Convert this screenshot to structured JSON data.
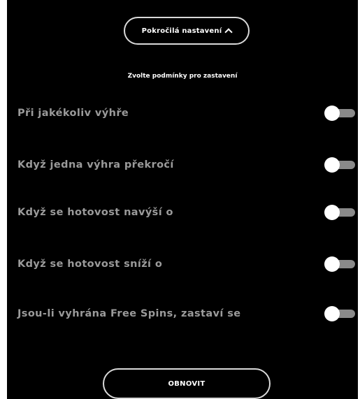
{
  "advanced_button": {
    "label": "Pokročilá nastavení",
    "icon": "chevron-up-icon"
  },
  "subtitle": "Zvolte podmínky pro zastavení",
  "options": [
    {
      "label": "Při jakékoliv výhře",
      "enabled": false
    },
    {
      "label": "Když jedna výhra překročí",
      "enabled": false
    },
    {
      "label": "Když se hotovost navýší o",
      "enabled": false
    },
    {
      "label": "Když se hotovost sníží o",
      "enabled": false
    },
    {
      "label": "Jsou-li vyhrána Free Spins, zastaví se",
      "enabled": false
    }
  ],
  "reset_button": {
    "label": "OBNOVIT"
  },
  "colors": {
    "background": "#000000",
    "label_text": "#9a9a9a",
    "toggle_track": "#8a8a8a",
    "toggle_knob": "#ffffff"
  }
}
